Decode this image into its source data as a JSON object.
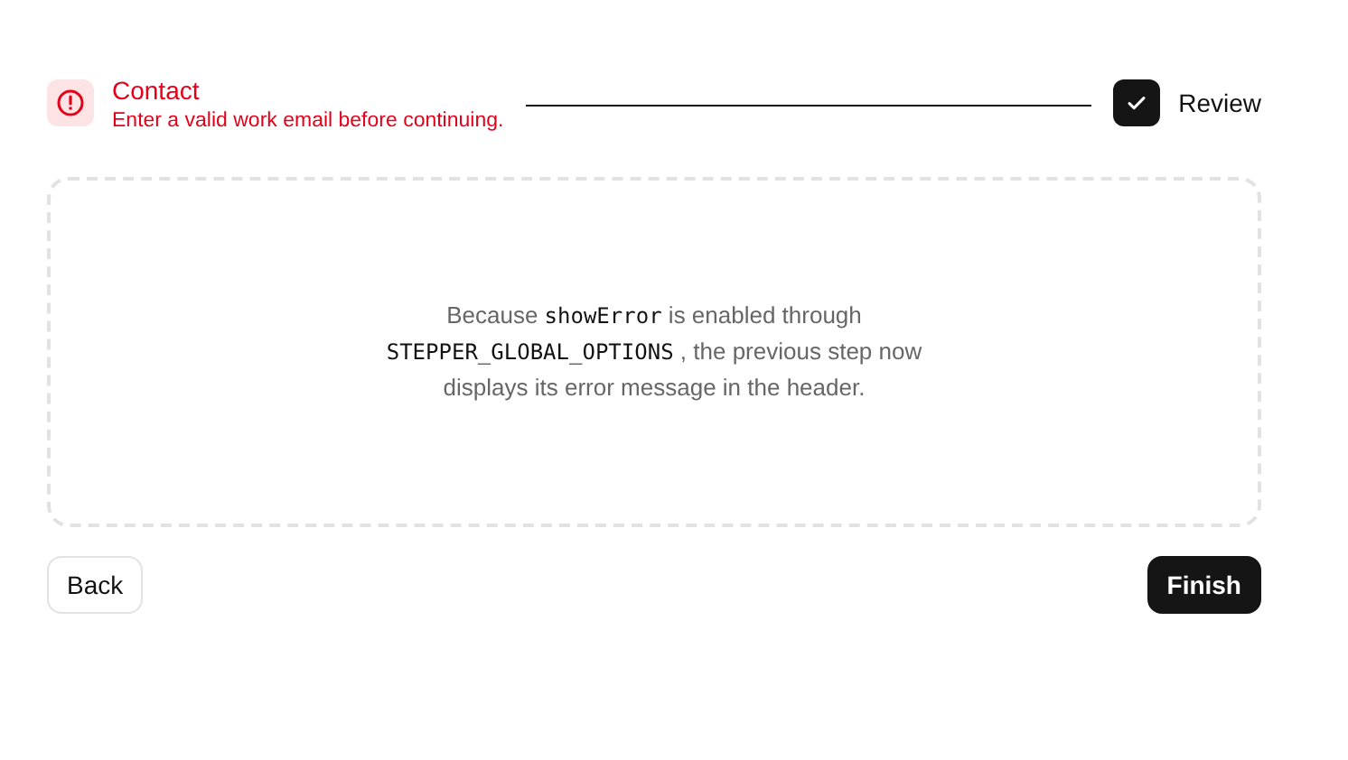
{
  "steps": [
    {
      "label": "Contact",
      "kind": "error",
      "message": "Enter a valid work email before continuing."
    },
    {
      "label": "Review",
      "kind": "completed"
    }
  ],
  "content": {
    "parts": [
      {
        "kind": "text",
        "text": "Because "
      },
      {
        "kind": "code",
        "text": "showError"
      },
      {
        "kind": "text",
        "text": " is enabled through "
      },
      {
        "kind": "code",
        "text": "STEPPER_GLOBAL_OPTIONS"
      },
      {
        "kind": "text",
        "text": " , the previous step now displays its error message in the header."
      }
    ]
  },
  "buttons": [
    {
      "label": "Back",
      "kind": "secondary"
    },
    {
      "label": "Finish",
      "kind": "primary"
    }
  ]
}
